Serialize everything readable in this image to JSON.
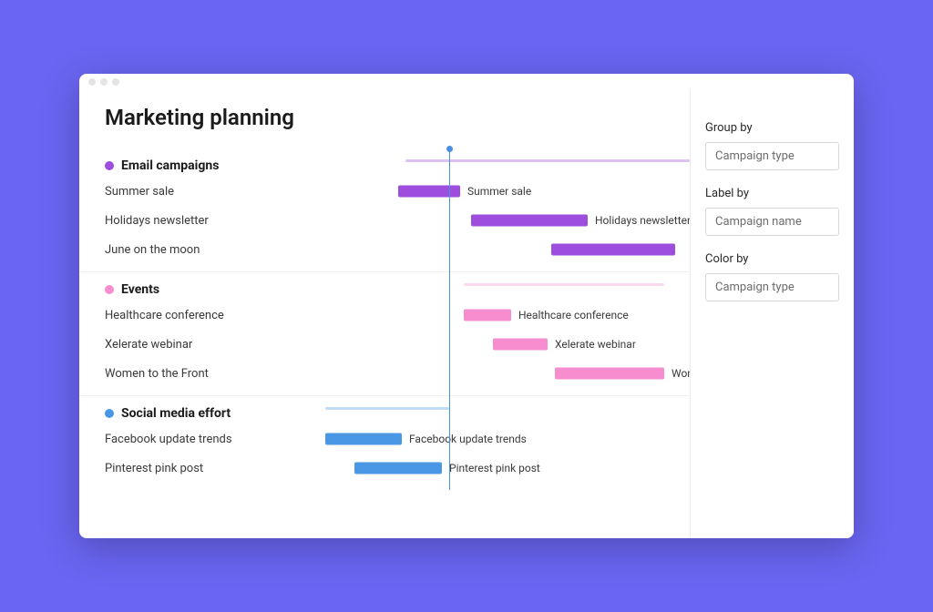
{
  "page_title": "Marketing planning",
  "sidebar": {
    "group_by_label": "Group by",
    "group_by_value": "Campaign type",
    "label_by_label": "Label by",
    "label_by_value": "Campaign name",
    "color_by_label": "Color by",
    "color_by_value": "Campaign type"
  },
  "colors": {
    "email": "#9d4edd",
    "events": "#f78ccf",
    "social": "#4a98e5"
  },
  "today_position_pct": 34,
  "chart_data": {
    "type": "bar",
    "title": "Marketing planning",
    "xlabel": "",
    "ylabel": "",
    "groups": [
      {
        "name": "Email campaigns",
        "color": "#9d4edd",
        "span": {
          "start_pct": 22,
          "end_pct": 100
        },
        "tasks": [
          {
            "name": "Summer sale",
            "start_pct": 20,
            "end_pct": 37,
            "bar_label": "Summer sale"
          },
          {
            "name": "Holidays newsletter",
            "start_pct": 40,
            "end_pct": 72,
            "bar_label": "Holidays newsletter"
          },
          {
            "name": "June on the moon",
            "start_pct": 62,
            "end_pct": 96,
            "bar_label": ""
          }
        ]
      },
      {
        "name": "Events",
        "color": "#f78ccf",
        "span": {
          "start_pct": 38,
          "end_pct": 93
        },
        "tasks": [
          {
            "name": "Healthcare conference",
            "start_pct": 38,
            "end_pct": 51,
            "bar_label": "Healthcare conference"
          },
          {
            "name": "Xelerate webinar",
            "start_pct": 46,
            "end_pct": 61,
            "bar_label": "Xelerate webinar"
          },
          {
            "name": "Women to the Front",
            "start_pct": 63,
            "end_pct": 93,
            "bar_label": "Women to the Front"
          }
        ]
      },
      {
        "name": "Social media effort",
        "color": "#4a98e5",
        "span": {
          "start_pct": 0,
          "end_pct": 34
        },
        "tasks": [
          {
            "name": "Facebook update trends",
            "start_pct": 0,
            "end_pct": 21,
            "bar_label": "Facebook update trends"
          },
          {
            "name": "Pinterest pink post",
            "start_pct": 8,
            "end_pct": 32,
            "bar_label": "Pinterest pink post"
          }
        ]
      }
    ]
  }
}
